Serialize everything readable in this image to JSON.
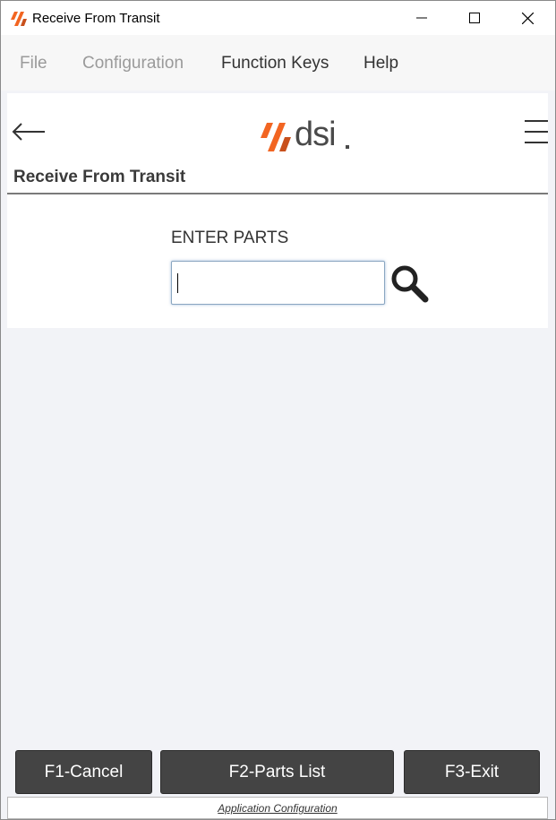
{
  "window": {
    "title": "Receive From Transit",
    "controls": [
      "minimize",
      "maximize",
      "close"
    ]
  },
  "menu": {
    "items": [
      {
        "label": "File",
        "enabled": false
      },
      {
        "label": "Configuration",
        "enabled": false
      },
      {
        "label": "Function Keys",
        "enabled": true
      },
      {
        "label": "Help",
        "enabled": true
      }
    ]
  },
  "header": {
    "back_icon": "arrow-left-icon",
    "logo_text": "dsi",
    "menu_icon": "hamburger-menu-icon",
    "brand_colors": {
      "orange": "#f26522",
      "dark_orange": "#c8501c",
      "text": "#4a4a4a"
    }
  },
  "page": {
    "heading": "Receive From Transit",
    "field_label": "ENTER PARTS",
    "input_value": "",
    "search_icon": "magnifier-icon"
  },
  "function_keys": [
    {
      "label": "F1-Cancel"
    },
    {
      "label": "F2-Parts List"
    },
    {
      "label": "F3-Exit"
    }
  ],
  "footer": {
    "link_label": "Application Configuration"
  }
}
